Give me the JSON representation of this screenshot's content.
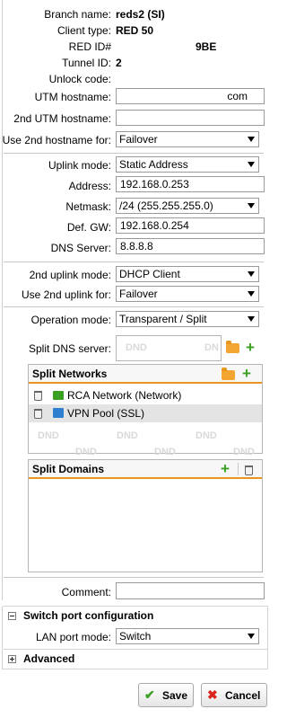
{
  "info": {
    "branch_name_label": "Branch name:",
    "branch_name_value": "reds2 (SI)",
    "client_type_label": "Client type:",
    "client_type_value": "RED 50",
    "red_id_label": "RED ID#",
    "red_id_value": "9BE",
    "tunnel_id_label": "Tunnel ID:",
    "tunnel_id_value": "2",
    "unlock_code_label": "Unlock code:"
  },
  "hostnames": {
    "utm_label": "UTM hostname:",
    "utm_value": "com",
    "second_utm_label": "2nd UTM hostname:",
    "second_utm_value": "",
    "use_second_label": "Use 2nd hostname for:",
    "use_second_value": "Failover"
  },
  "uplink": {
    "mode_label": "Uplink mode:",
    "mode_value": "Static Address",
    "address_label": "Address:",
    "address_value": "192.168.0.253",
    "netmask_label": "Netmask:",
    "netmask_value": "/24 (255.255.255.0)",
    "gw_label": "Def. GW:",
    "gw_value": "192.168.0.254",
    "dns_label": "DNS Server:",
    "dns_value": "8.8.8.8"
  },
  "uplink2": {
    "mode_label": "2nd uplink mode:",
    "mode_value": "DHCP Client",
    "use_label": "Use 2nd uplink for:",
    "use_value": "Failover"
  },
  "operation": {
    "label": "Operation mode:",
    "value": "Transparent / Split"
  },
  "split_dns": {
    "label": "Split DNS server:",
    "placeholder_a": "DND",
    "placeholder_b": "DN"
  },
  "split_networks": {
    "title": "Split Networks",
    "items": [
      {
        "label": "RCA Network (Network)",
        "icon": "network-icon",
        "color": "#3aa021"
      },
      {
        "label": "VPN Pool (SSL)",
        "icon": "vpn-pool-icon",
        "color": "#2f7fd0"
      }
    ],
    "drop_placeholder": "DND"
  },
  "split_domains": {
    "title": "Split Domains"
  },
  "comment": {
    "label": "Comment:",
    "value": ""
  },
  "switch_port": {
    "title": "Switch port configuration",
    "lan_label": "LAN port mode:",
    "lan_value": "Switch"
  },
  "advanced": {
    "title": "Advanced"
  },
  "buttons": {
    "save": "Save",
    "cancel": "Cancel"
  },
  "colors": {
    "accent": "#e8961e",
    "add": "#3aa021",
    "cancel": "#d9261c"
  }
}
